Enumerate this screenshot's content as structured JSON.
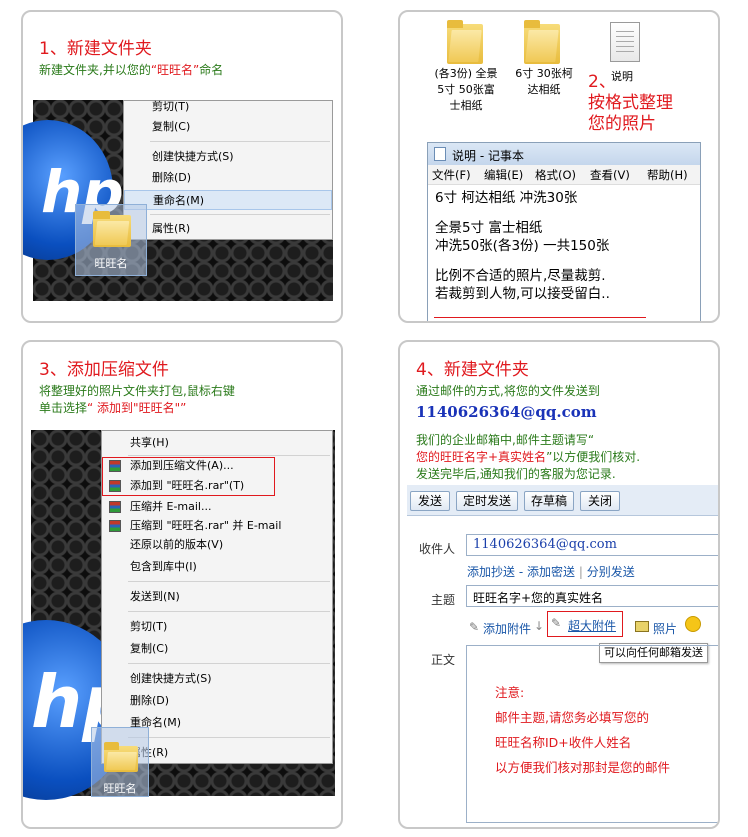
{
  "p1": {
    "title": "1、新建文件夹",
    "desc_a": "新建文件夹,并以您的",
    "desc_b": "“旺旺名”",
    "desc_c": "命名",
    "menu": [
      "剪切(T)",
      "复制(C)",
      "创建快捷方式(S)",
      "删除(D)",
      "重命名(M)",
      "属性(R)"
    ],
    "folder_label": "旺旺名"
  },
  "p2": {
    "folders": [
      "(各3份) 全景5寸 50张富士相纸",
      "6寸 30张柯达相纸"
    ],
    "file_label": "说明",
    "note_a": "2、",
    "note_b": "按格式整理",
    "note_c": "您的照片",
    "notepad_title": "说明 - 记事本",
    "notepad_menu": [
      "文件(F)",
      "编辑(E)",
      "格式(O)",
      "查看(V)",
      "帮助(H)"
    ],
    "lines": [
      "6寸 柯达相纸 冲洗30张",
      "全景5寸 富士相纸",
      "冲洗50张(各3份) 一共150张",
      "比例不合适的照片,尽量裁剪.",
      "若裁剪到人物,可以接受留白.."
    ]
  },
  "p3": {
    "title": "3、添加压缩文件",
    "desc1": "将整理好的照片文件夹打包,鼠标右键",
    "desc2a": "单击选择",
    "desc2b": "“ 添加到\"旺旺名\"”",
    "menu": [
      "共享(H)",
      "添加到压缩文件(A)...",
      "添加到 \"旺旺名.rar\"(T)",
      "压缩并 E-mail...",
      "压缩到 \"旺旺名.rar\" 并 E-mail",
      "还原以前的版本(V)",
      "包含到库中(I)",
      "发送到(N)",
      "剪切(T)",
      "复制(C)",
      "创建快捷方式(S)",
      "删除(D)",
      "重命名(M)",
      "属性(R)"
    ],
    "folder_label": "旺旺名"
  },
  "p4": {
    "title": "4、新建文件夹",
    "desc1": "通过邮件的方式,将您的文件发送到",
    "email": "1140626364@qq.com",
    "desc3": "我们的企业邮箱中,邮件主题请写“",
    "desc4a": "您的旺旺名字+真实姓名",
    "desc4b": "”以方便我们核对.",
    "desc5": "发送完毕后,通知我们的客服为您记录.",
    "toolbar": [
      "发送",
      "定时发送",
      "存草稿",
      "关闭"
    ],
    "to_label": "收件人",
    "to_value": "1140626364@qq.com",
    "links": [
      "添加抄送",
      "添加密送",
      "分别发送"
    ],
    "link_sep": "-",
    "link_sep2": "|",
    "subject_label": "主题",
    "subject_value": "旺旺名字+您的真实姓名",
    "attach": "添加附件",
    "big_attach": "超大附件",
    "photo": "照片",
    "tooltip": "可以向任何邮箱发送",
    "body_label": "正文",
    "note": [
      "注意:",
      "邮件主题,请您务必填写您的",
      "旺旺名称ID+收件人姓名",
      "以方便我们核对那封是您的邮件"
    ]
  },
  "colors": {
    "red": "#e0191e",
    "green": "#2a7a1a",
    "blue": "#1a33b8"
  }
}
